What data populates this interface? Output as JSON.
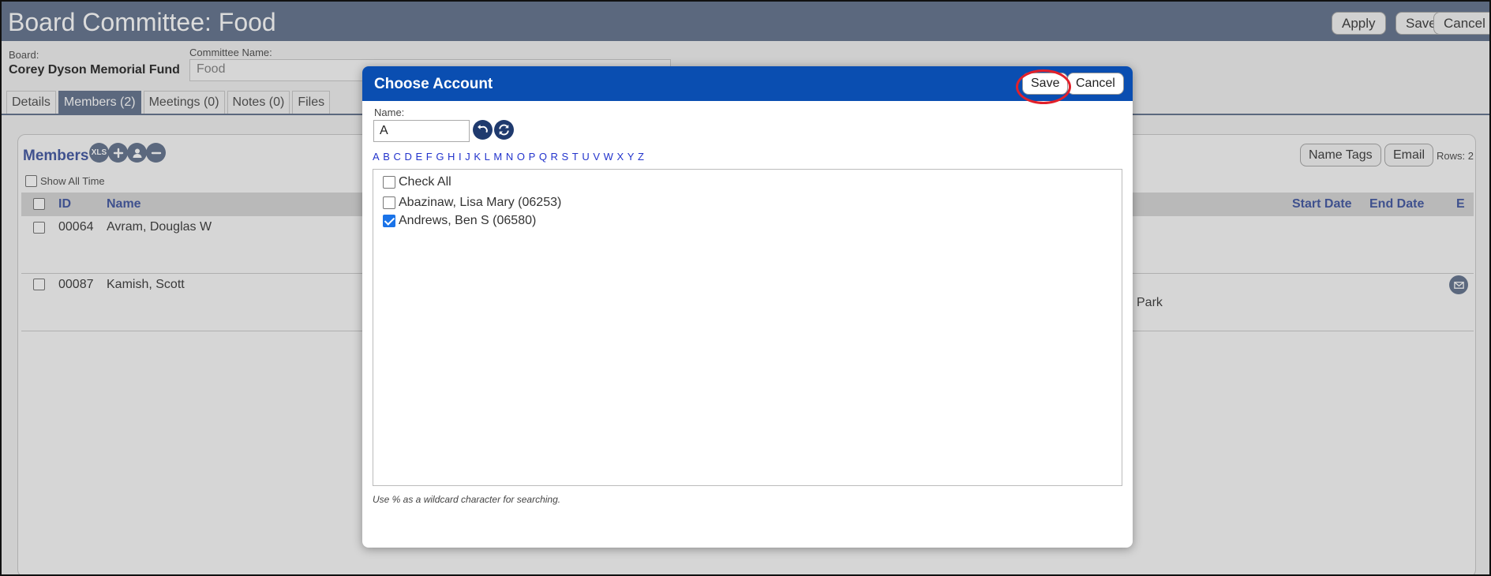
{
  "header": {
    "title": "Board Committee: Food",
    "buttons": {
      "apply": "Apply",
      "save": "Save",
      "cancel": "Cancel"
    }
  },
  "board": {
    "label": "Board:",
    "value": "Corey Dyson Memorial Fund"
  },
  "committee": {
    "label": "Committee Name:",
    "value": "Food"
  },
  "tabs": [
    {
      "label": "Details"
    },
    {
      "label": "Members (2)"
    },
    {
      "label": "Meetings (0)"
    },
    {
      "label": "Notes (0)"
    },
    {
      "label": "Files"
    }
  ],
  "members": {
    "title": "Members",
    "xls_label": "XLS",
    "show_all_time": "Show All Time",
    "name_tags": "Name Tags",
    "email": "Email",
    "rows": "Rows: 2",
    "columns": {
      "id": "ID",
      "name": "Name",
      "start_date": "Start Date",
      "end_date": "End Date",
      "e": "E"
    },
    "table": [
      {
        "id": "00064",
        "name": "Avram, Douglas W",
        "extra": ""
      },
      {
        "id": "00087",
        "name": "Kamish, Scott",
        "extra": "Park"
      }
    ]
  },
  "modal": {
    "title": "Choose Account",
    "save": "Save",
    "cancel": "Cancel",
    "name_label": "Name:",
    "name_value": "A",
    "letters": [
      "A",
      "B",
      "C",
      "D",
      "E",
      "F",
      "G",
      "H",
      "I",
      "J",
      "K",
      "L",
      "M",
      "N",
      "O",
      "P",
      "Q",
      "R",
      "S",
      "T",
      "U",
      "V",
      "W",
      "X",
      "Y",
      "Z"
    ],
    "check_all": "Check All",
    "accounts": [
      {
        "label": "Abazinaw, Lisa Mary (06253)",
        "checked": false
      },
      {
        "label": "Andrews, Ben S (06580)",
        "checked": true
      }
    ],
    "hint": "Use % as a wildcard character for searching."
  },
  "colors": {
    "header": "#6b7a93",
    "modal_header": "#0a4eb1",
    "link": "#2233cc",
    "highlight": "#e2202a"
  }
}
